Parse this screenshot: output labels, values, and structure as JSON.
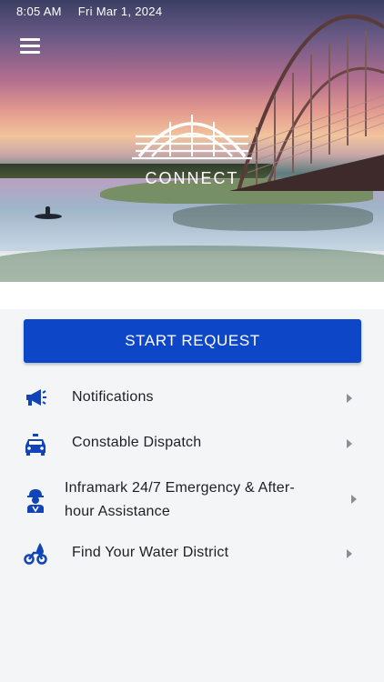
{
  "status_bar": {
    "time": "8:05 AM",
    "date": "Fri Mar 1, 2024"
  },
  "hero": {
    "logo_text": "CONNECT"
  },
  "actions": {
    "start_request": "START REQUEST"
  },
  "menu": [
    {
      "label": "Notifications",
      "icon": "megaphone-icon"
    },
    {
      "label": "Constable Dispatch",
      "icon": "police-car-icon"
    },
    {
      "label_line1": "Inframark 24/7 Emergency & After-",
      "label_line2": "hour Assistance",
      "icon": "worker-icon"
    },
    {
      "label": "Find Your Water District",
      "icon": "water-district-icon"
    }
  ],
  "colors": {
    "accent": "#0d47c7",
    "icon": "#1144b8"
  }
}
